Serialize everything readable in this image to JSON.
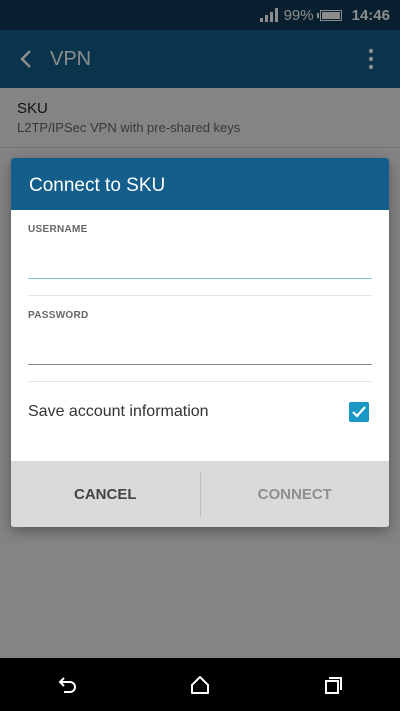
{
  "status_bar": {
    "battery_percent": "99%",
    "time": "14:46",
    "icons": [
      "signal-icon",
      "battery-icon"
    ]
  },
  "app_bar": {
    "title": "VPN",
    "icons": [
      "back-arrow-icon",
      "overflow-menu-icon"
    ]
  },
  "vpn_list": [
    {
      "name": "SKU",
      "type": "L2TP/IPSec VPN with pre-shared keys"
    }
  ],
  "dialog": {
    "title": "Connect to SKU",
    "username": {
      "label": "USERNAME",
      "value": "",
      "placeholder": ""
    },
    "password": {
      "label": "PASSWORD",
      "value": "",
      "placeholder": ""
    },
    "save_account": {
      "label": "Save account information",
      "checked": true
    },
    "cancel_label": "CANCEL",
    "connect_label": "CONNECT"
  },
  "nav_bar": {
    "icons": [
      "back-icon",
      "home-icon",
      "recents-icon"
    ]
  },
  "colors": {
    "status_bar": "#0d3a56",
    "app_bar": "#135e8a",
    "dialog_header": "#135e8a",
    "accent": "#1a98c5",
    "focused_underline": "#7cc6d8"
  }
}
